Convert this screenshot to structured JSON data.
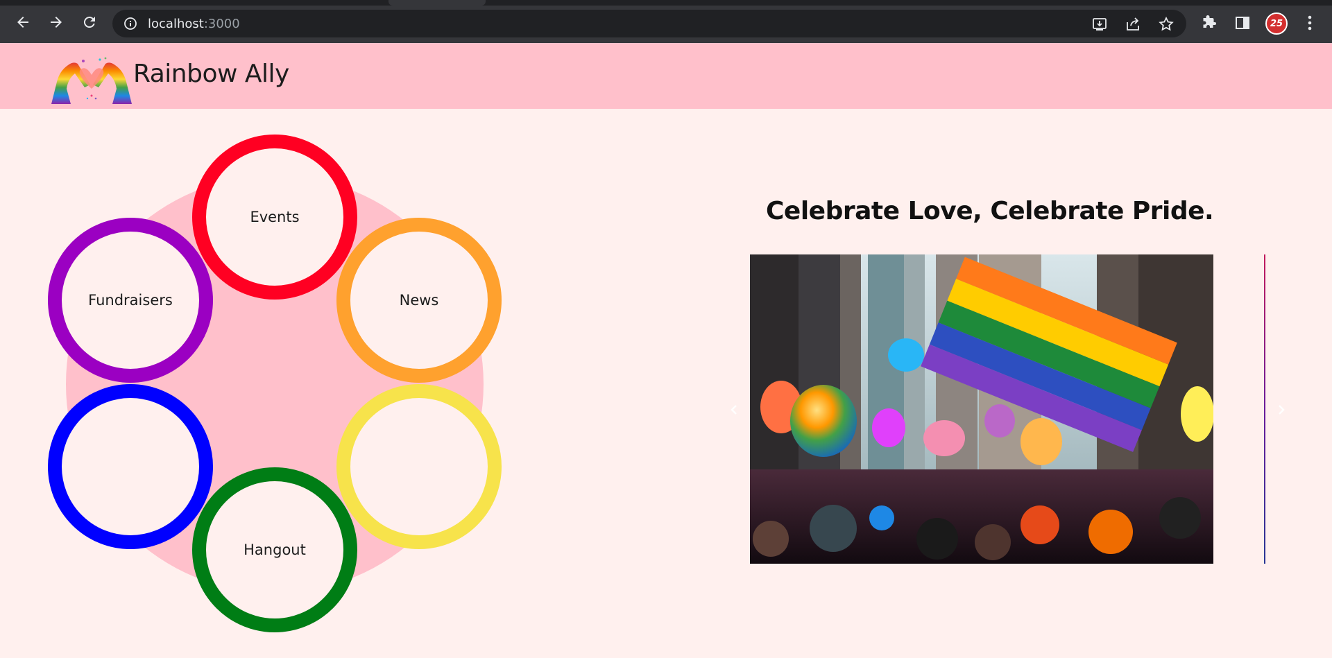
{
  "browser": {
    "url_host": "localhost",
    "url_port": ":3000",
    "icons": [
      "back-icon",
      "forward-icon",
      "reload-icon",
      "info-icon",
      "install-icon",
      "share-icon",
      "bookmark-star-icon",
      "extensions-icon",
      "side-panel-icon",
      "profile-avatar",
      "more-menu-icon"
    ]
  },
  "header": {
    "brand": "Rainbow Ally",
    "background": "#ffc0cb"
  },
  "menu": {
    "background": "#ffc0cb",
    "rings": [
      {
        "label": "Events",
        "color": "#ff0022"
      },
      {
        "label": "News",
        "color": "#ffa12e"
      },
      {
        "label": "",
        "color": "#f7e34b"
      },
      {
        "label": "Hangout",
        "color": "#007d15"
      },
      {
        "label": "",
        "color": "#0000ff"
      },
      {
        "label": "Fundraisers",
        "color": "#9b00c2"
      }
    ]
  },
  "hero": {
    "headline": "Celebrate Love, Celebrate Pride."
  },
  "carousel": {
    "prev_icon": "chevron-left-icon",
    "next_icon": "chevron-right-icon"
  }
}
